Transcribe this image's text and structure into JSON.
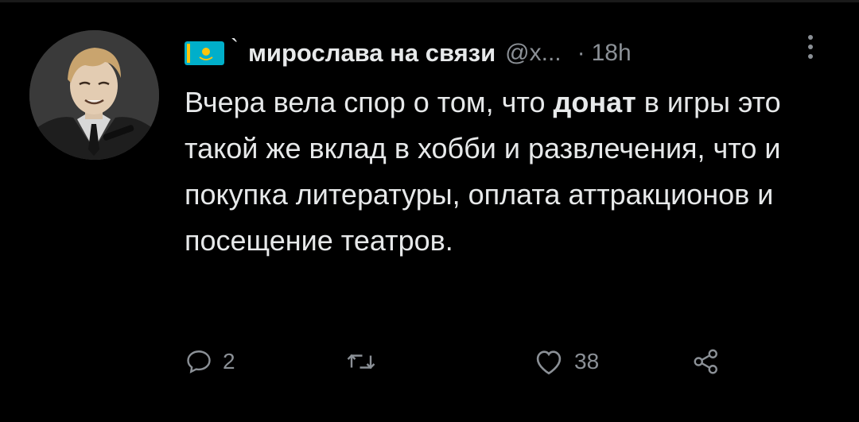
{
  "author": {
    "display_name": "мирослава на связи",
    "handle": "@x...",
    "name_suffix": "`",
    "flag_icon": "kazakhstan-flag-icon"
  },
  "meta": {
    "separator": "·",
    "time": "18h"
  },
  "tweet": {
    "text_parts": [
      "Вчера вела спор о том, что ",
      "донат",
      " в игры это такой же вклад в хобби и развлечения, что и покупка литературы, оплата аттракционов и посещение театров."
    ]
  },
  "actions": {
    "reply_count": "2",
    "retweet_count": "",
    "like_count": "38",
    "icons": [
      "reply-icon",
      "retweet-icon",
      "like-icon",
      "share-icon"
    ]
  },
  "colors": {
    "background": "#000000",
    "text": "#e7e9ea",
    "muted": "#8b9096",
    "flag_blue": "#00afca",
    "flag_gold": "#fec50c"
  }
}
